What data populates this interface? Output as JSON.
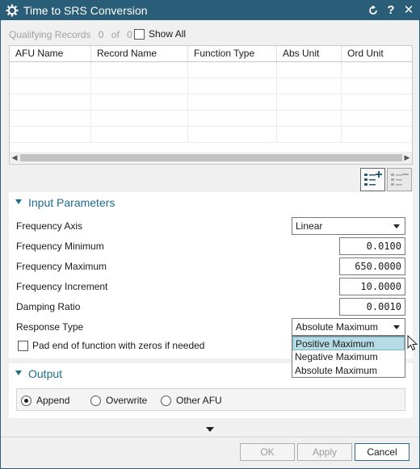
{
  "window": {
    "title": "Time to SRS Conversion",
    "controls": [
      "reset-icon",
      "help-icon",
      "close-icon"
    ],
    "accent": "#2a5d78"
  },
  "qualifying": {
    "label": "Qualifying Records",
    "count": "0",
    "of": "of",
    "total": "0",
    "show_all": "Show All"
  },
  "records_table": {
    "columns": [
      "AFU Name",
      "Record Name",
      "Function Type",
      "Abs Unit",
      "Ord Unit"
    ],
    "rows": []
  },
  "input_parameters": {
    "title": "Input Parameters",
    "frequency_axis": {
      "label": "Frequency Axis",
      "value": "Linear"
    },
    "frequency_minimum": {
      "label": "Frequency Minimum",
      "value": "0.0100"
    },
    "frequency_maximum": {
      "label": "Frequency Maximum",
      "value": "650.0000"
    },
    "frequency_increment": {
      "label": "Frequency Increment",
      "value": "10.0000"
    },
    "damping_ratio": {
      "label": "Damping Ratio",
      "value": "0.0010"
    },
    "response_type": {
      "label": "Response Type",
      "value": "Absolute Maximum",
      "options": [
        "Positive Maximum",
        "Negative Maximum",
        "Absolute Maximum"
      ],
      "highlighted": "Positive Maximum"
    },
    "pad_zeros": "Pad end of function with zeros if needed"
  },
  "output": {
    "title": "Output",
    "options": [
      "Append",
      "Overwrite",
      "Other AFU"
    ],
    "selected": "Append"
  },
  "footer": {
    "ok": "OK",
    "apply": "Apply",
    "cancel": "Cancel"
  }
}
